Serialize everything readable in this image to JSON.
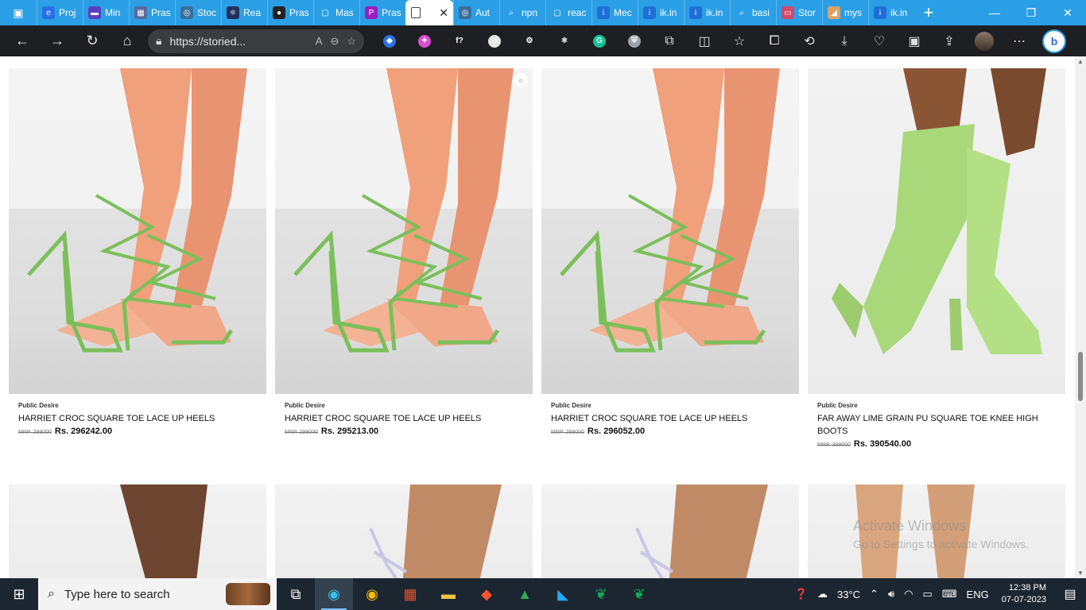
{
  "browser": {
    "tabs": [
      {
        "label": "Proj",
        "fav_color": "#2b6fe6",
        "fav": "e"
      },
      {
        "label": "Min",
        "fav_color": "#5b3fbf",
        "fav": "▬"
      },
      {
        "label": "Pras",
        "fav_color": "#5a6aa0",
        "fav": "▦"
      },
      {
        "label": "Stoc",
        "fav_color": "#3a6f9a",
        "fav": "◎"
      },
      {
        "label": "Rea",
        "fav_color": "#20305a",
        "fav": "⚛"
      },
      {
        "label": "Pras",
        "fav_color": "#222222",
        "fav": "●"
      },
      {
        "label": "Mas",
        "fav_color": "#2b9fe6",
        "fav": "▢"
      },
      {
        "label": "Pras",
        "fav_color": "#9b1fbf",
        "fav": "P"
      },
      {
        "label": "Aut",
        "fav_color": "#3a6f9a",
        "fav": "◎"
      },
      {
        "label": "npn",
        "fav_color": "#2b9fe6",
        "fav": "⌕"
      },
      {
        "label": "reac",
        "fav_color": "#2b9fe6",
        "fav": "▢"
      },
      {
        "label": "Mec",
        "fav_color": "#1e6fd6",
        "fav": "i"
      },
      {
        "label": "ik.in",
        "fav_color": "#1e6fd6",
        "fav": "i"
      },
      {
        "label": "ik.in",
        "fav_color": "#1e6fd6",
        "fav": "i"
      },
      {
        "label": "basi",
        "fav_color": "#2b9fe6",
        "fav": "⌕"
      },
      {
        "label": "Stor",
        "fav_color": "#d04a6a",
        "fav": "▭"
      },
      {
        "label": "mys",
        "fav_color": "#e0a060",
        "fav": "◢"
      },
      {
        "label": "ik.in",
        "fav_color": "#1e6fd6",
        "fav": "i"
      }
    ],
    "active_tab_index": 8,
    "address": "https://storied...",
    "extensions": [
      {
        "name": "blue-diamond",
        "color": "#2b6fe6",
        "glyph": "◆"
      },
      {
        "name": "color-wheel",
        "color": "#d94fd0",
        "glyph": "✦"
      },
      {
        "name": "function",
        "color": "#1e1f22",
        "glyph": "f?"
      },
      {
        "name": "face",
        "color": "#e6e6e6",
        "glyph": "☺"
      },
      {
        "name": "react-gear",
        "color": "#1e1f22",
        "glyph": "⚙"
      },
      {
        "name": "react-atom",
        "color": "#1e1f22",
        "glyph": "⚛"
      },
      {
        "name": "grammarly",
        "color": "#15c39a",
        "glyph": "G"
      },
      {
        "name": "shield",
        "color": "#9aa0a6",
        "glyph": "⛨"
      }
    ]
  },
  "products": [
    {
      "brand": "Public Desire",
      "name": "HARRIET CROC SQUARE TOE LACE UP HEELS",
      "mrp": "MRP. 299000",
      "price": "Rs. 296242.00"
    },
    {
      "brand": "Public Desire",
      "name": "HARRIET CROC SQUARE TOE LACE UP HEELS",
      "mrp": "MRP. 299000",
      "price": "Rs. 295213.00"
    },
    {
      "brand": "Public Desire",
      "name": "HARRIET CROC SQUARE TOE LACE UP HEELS",
      "mrp": "MRP. 299000",
      "price": "Rs. 296052.00"
    },
    {
      "brand": "Public Desire",
      "name": "FAR AWAY LIME GRAIN PU SQUARE TOE KNEE HIGH BOOTS",
      "mrp": "MRP. 399000",
      "price": "Rs. 390540.00"
    }
  ],
  "watermark": {
    "line1": "Activate Windows",
    "line2": "Go to Settings to activate Windows."
  },
  "taskbar": {
    "search_placeholder": "Type here to search",
    "temperature": "33°C",
    "lang": "ENG",
    "time": "12:38 PM",
    "date": "07-07-2023"
  }
}
